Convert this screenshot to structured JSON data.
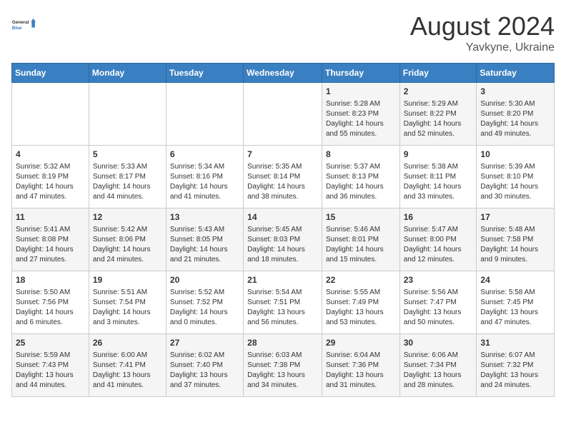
{
  "logo": {
    "line1": "General",
    "line2": "Blue"
  },
  "title": "August 2024",
  "subtitle": "Yavkyne, Ukraine",
  "days_of_week": [
    "Sunday",
    "Monday",
    "Tuesday",
    "Wednesday",
    "Thursday",
    "Friday",
    "Saturday"
  ],
  "weeks": [
    [
      {
        "num": "",
        "info": ""
      },
      {
        "num": "",
        "info": ""
      },
      {
        "num": "",
        "info": ""
      },
      {
        "num": "",
        "info": ""
      },
      {
        "num": "1",
        "info": "Sunrise: 5:28 AM\nSunset: 8:23 PM\nDaylight: 14 hours\nand 55 minutes."
      },
      {
        "num": "2",
        "info": "Sunrise: 5:29 AM\nSunset: 8:22 PM\nDaylight: 14 hours\nand 52 minutes."
      },
      {
        "num": "3",
        "info": "Sunrise: 5:30 AM\nSunset: 8:20 PM\nDaylight: 14 hours\nand 49 minutes."
      }
    ],
    [
      {
        "num": "4",
        "info": "Sunrise: 5:32 AM\nSunset: 8:19 PM\nDaylight: 14 hours\nand 47 minutes."
      },
      {
        "num": "5",
        "info": "Sunrise: 5:33 AM\nSunset: 8:17 PM\nDaylight: 14 hours\nand 44 minutes."
      },
      {
        "num": "6",
        "info": "Sunrise: 5:34 AM\nSunset: 8:16 PM\nDaylight: 14 hours\nand 41 minutes."
      },
      {
        "num": "7",
        "info": "Sunrise: 5:35 AM\nSunset: 8:14 PM\nDaylight: 14 hours\nand 38 minutes."
      },
      {
        "num": "8",
        "info": "Sunrise: 5:37 AM\nSunset: 8:13 PM\nDaylight: 14 hours\nand 36 minutes."
      },
      {
        "num": "9",
        "info": "Sunrise: 5:38 AM\nSunset: 8:11 PM\nDaylight: 14 hours\nand 33 minutes."
      },
      {
        "num": "10",
        "info": "Sunrise: 5:39 AM\nSunset: 8:10 PM\nDaylight: 14 hours\nand 30 minutes."
      }
    ],
    [
      {
        "num": "11",
        "info": "Sunrise: 5:41 AM\nSunset: 8:08 PM\nDaylight: 14 hours\nand 27 minutes."
      },
      {
        "num": "12",
        "info": "Sunrise: 5:42 AM\nSunset: 8:06 PM\nDaylight: 14 hours\nand 24 minutes."
      },
      {
        "num": "13",
        "info": "Sunrise: 5:43 AM\nSunset: 8:05 PM\nDaylight: 14 hours\nand 21 minutes."
      },
      {
        "num": "14",
        "info": "Sunrise: 5:45 AM\nSunset: 8:03 PM\nDaylight: 14 hours\nand 18 minutes."
      },
      {
        "num": "15",
        "info": "Sunrise: 5:46 AM\nSunset: 8:01 PM\nDaylight: 14 hours\nand 15 minutes."
      },
      {
        "num": "16",
        "info": "Sunrise: 5:47 AM\nSunset: 8:00 PM\nDaylight: 14 hours\nand 12 minutes."
      },
      {
        "num": "17",
        "info": "Sunrise: 5:48 AM\nSunset: 7:58 PM\nDaylight: 14 hours\nand 9 minutes."
      }
    ],
    [
      {
        "num": "18",
        "info": "Sunrise: 5:50 AM\nSunset: 7:56 PM\nDaylight: 14 hours\nand 6 minutes."
      },
      {
        "num": "19",
        "info": "Sunrise: 5:51 AM\nSunset: 7:54 PM\nDaylight: 14 hours\nand 3 minutes."
      },
      {
        "num": "20",
        "info": "Sunrise: 5:52 AM\nSunset: 7:52 PM\nDaylight: 14 hours\nand 0 minutes."
      },
      {
        "num": "21",
        "info": "Sunrise: 5:54 AM\nSunset: 7:51 PM\nDaylight: 13 hours\nand 56 minutes."
      },
      {
        "num": "22",
        "info": "Sunrise: 5:55 AM\nSunset: 7:49 PM\nDaylight: 13 hours\nand 53 minutes."
      },
      {
        "num": "23",
        "info": "Sunrise: 5:56 AM\nSunset: 7:47 PM\nDaylight: 13 hours\nand 50 minutes."
      },
      {
        "num": "24",
        "info": "Sunrise: 5:58 AM\nSunset: 7:45 PM\nDaylight: 13 hours\nand 47 minutes."
      }
    ],
    [
      {
        "num": "25",
        "info": "Sunrise: 5:59 AM\nSunset: 7:43 PM\nDaylight: 13 hours\nand 44 minutes."
      },
      {
        "num": "26",
        "info": "Sunrise: 6:00 AM\nSunset: 7:41 PM\nDaylight: 13 hours\nand 41 minutes."
      },
      {
        "num": "27",
        "info": "Sunrise: 6:02 AM\nSunset: 7:40 PM\nDaylight: 13 hours\nand 37 minutes."
      },
      {
        "num": "28",
        "info": "Sunrise: 6:03 AM\nSunset: 7:38 PM\nDaylight: 13 hours\nand 34 minutes."
      },
      {
        "num": "29",
        "info": "Sunrise: 6:04 AM\nSunset: 7:36 PM\nDaylight: 13 hours\nand 31 minutes."
      },
      {
        "num": "30",
        "info": "Sunrise: 6:06 AM\nSunset: 7:34 PM\nDaylight: 13 hours\nand 28 minutes."
      },
      {
        "num": "31",
        "info": "Sunrise: 6:07 AM\nSunset: 7:32 PM\nDaylight: 13 hours\nand 24 minutes."
      }
    ]
  ]
}
